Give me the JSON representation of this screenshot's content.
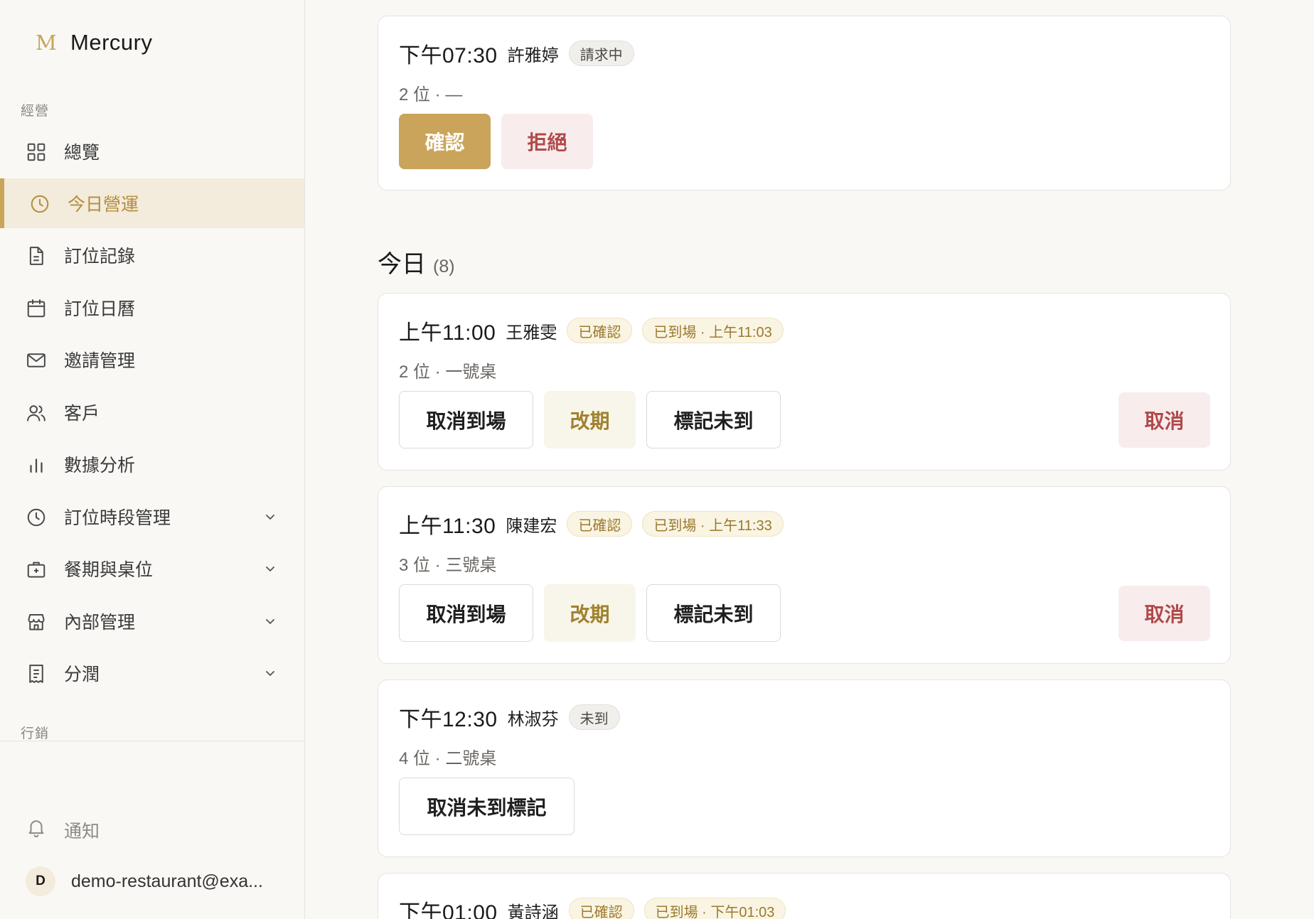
{
  "brand": {
    "logo": "M",
    "name": "Mercury"
  },
  "sidebar": {
    "sections": [
      {
        "label": "經營"
      },
      {
        "label": "行銷"
      }
    ],
    "items": [
      {
        "label": "總覽",
        "icon": "grid-icon"
      },
      {
        "label": "今日營運",
        "icon": "clock-icon",
        "active": true
      },
      {
        "label": "訂位記錄",
        "icon": "document-icon"
      },
      {
        "label": "訂位日曆",
        "icon": "calendar-icon"
      },
      {
        "label": "邀請管理",
        "icon": "mail-icon"
      },
      {
        "label": "客戶",
        "icon": "users-icon"
      },
      {
        "label": "數據分析",
        "icon": "bar-chart-icon"
      },
      {
        "label": "訂位時段管理",
        "icon": "clock-icon",
        "expandable": true
      },
      {
        "label": "餐期與桌位",
        "icon": "briefcase-icon",
        "expandable": true
      },
      {
        "label": "內部管理",
        "icon": "store-icon",
        "expandable": true
      },
      {
        "label": "分潤",
        "icon": "receipt-icon",
        "expandable": true
      }
    ],
    "notification": {
      "label": "通知",
      "icon": "bell-icon"
    },
    "account": {
      "initial": "D",
      "email": "demo-restaurant@exa..."
    }
  },
  "colors": {
    "accent": "#c9a45a",
    "accent_text": "#b48c3c",
    "active_bg": "#f3ebdb",
    "danger": "#b04a4a"
  },
  "pending": {
    "card": {
      "time": "下午07:30",
      "name": "許雅婷",
      "badges": [
        "請求中"
      ],
      "details": "2 位 · —",
      "actions": {
        "confirm": "確認",
        "reject": "拒絕"
      }
    }
  },
  "today": {
    "title": "今日",
    "count": "(8)",
    "reservations": [
      {
        "time": "上午11:00",
        "name": "王雅雯",
        "status": "已確認",
        "arrival": "已到場 · 上午11:03",
        "details": "2 位 · 一號桌",
        "actions": {
          "cancel_arrival": "取消到場",
          "reschedule": "改期",
          "mark_no_show": "標記未到",
          "cancel": "取消"
        }
      },
      {
        "time": "上午11:30",
        "name": "陳建宏",
        "status": "已確認",
        "arrival": "已到場 · 上午11:33",
        "details": "3 位 · 三號桌",
        "actions": {
          "cancel_arrival": "取消到場",
          "reschedule": "改期",
          "mark_no_show": "標記未到",
          "cancel": "取消"
        }
      },
      {
        "time": "下午12:30",
        "name": "林淑芬",
        "status": "未到",
        "details": "4 位 · 二號桌",
        "actions": {
          "undo_no_show": "取消未到標記"
        }
      },
      {
        "time": "下午01:00",
        "name": "黃詩涵",
        "status": "已確認",
        "arrival": "已到場 · 下午01:03"
      }
    ]
  }
}
